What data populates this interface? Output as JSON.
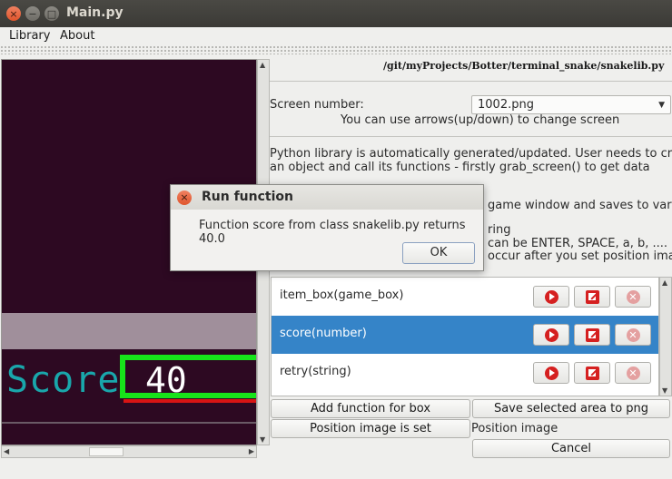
{
  "window": {
    "title": "Main.py",
    "close_glyph": "×",
    "min_glyph": "−",
    "max_glyph": "□"
  },
  "menu": [
    {
      "label": "Library"
    },
    {
      "label": "About"
    }
  ],
  "game": {
    "score_label": "Score",
    "score_value": "40"
  },
  "right": {
    "path": "/git/myProjects/Botter/terminal_snake/snakelib.py",
    "screen_label": "Screen number:",
    "screen_value": "1002.png",
    "hint": "You can use arrows(up/down) to change screen",
    "desc_line1": "Python library is automatically generated/updated. User needs to create",
    "desc_line2": "an object and call its functions - firstly grab_screen() to get data",
    "desc_line3": "game window and saves to var",
    "desc_line4": "ring",
    "desc_line5": "can be ENTER, SPACE, a, b, ....",
    "desc_line6": "occur after you set position image"
  },
  "functions": [
    {
      "label": "item_box(game_box)",
      "selected": false
    },
    {
      "label": "score(number)",
      "selected": true
    },
    {
      "label": "retry(string)",
      "selected": false
    }
  ],
  "icons": {
    "run": "play-icon",
    "edit": "edit-icon",
    "delete": "delete-icon"
  },
  "buttons": {
    "add_function": "Add function for box",
    "save_area": "Save selected area to png",
    "position_set": "Position image is set",
    "position_image": "Position image",
    "cancel": "Cancel"
  },
  "dialog": {
    "title": "Run function",
    "message": "Function score from class snakelib.py returns 40.0",
    "ok": "OK",
    "close_glyph": "×"
  },
  "colors": {
    "accent": "#3584c8",
    "game_bg": "#2d0922",
    "highlight_green": "#17e31a",
    "red": "#d52020"
  }
}
